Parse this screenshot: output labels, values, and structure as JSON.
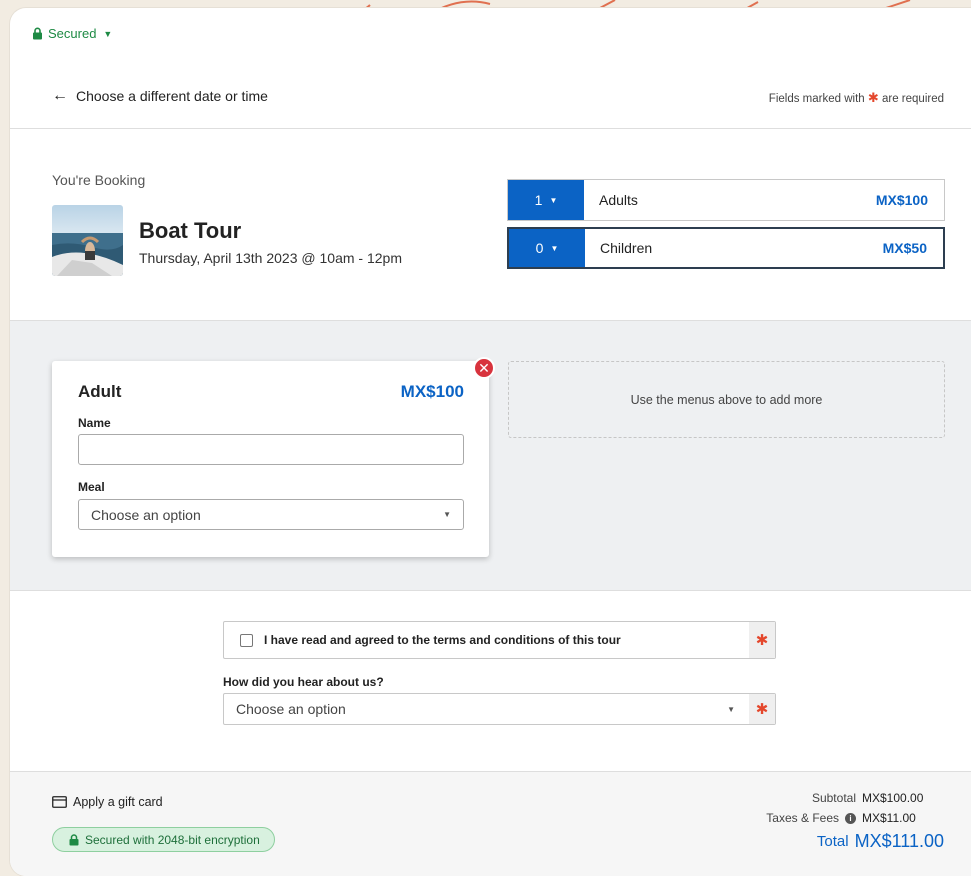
{
  "header": {
    "secured_label": "Secured",
    "back_label": "Choose a different date or time",
    "required_prefix": "Fields marked with",
    "required_star": "✱",
    "required_suffix": "are required"
  },
  "booking": {
    "label": "You're Booking",
    "title": "Boat Tour",
    "datetime": "Thursday, April 13th 2023 @ 10am - 12pm"
  },
  "tickets": [
    {
      "qty": "1",
      "name": "Adults",
      "price": "MX$100"
    },
    {
      "qty": "0",
      "name": "Children",
      "price": "MX$50"
    }
  ],
  "guest": {
    "title": "Adult",
    "price": "MX$100",
    "name_label": "Name",
    "name_value": "",
    "meal_label": "Meal",
    "meal_value": "Choose an option",
    "remove_glyph": "✕"
  },
  "add_more": "Use the menus above to add more",
  "terms": {
    "label": "I have read and agreed to the terms and conditions of this tour",
    "star": "✱"
  },
  "hear": {
    "label": "How did you hear about us?",
    "value": "Choose an option",
    "star": "✱"
  },
  "footer": {
    "gift_label": "Apply a gift card",
    "encryption_label": "Secured with 2048-bit encryption",
    "subtotal_label": "Subtotal",
    "subtotal_value": "MX$100.00",
    "taxes_label": "Taxes & Fees",
    "taxes_value": "MX$11.00",
    "total_label": "Total",
    "total_value": "MX$111.00"
  },
  "colors": {
    "accent_blue": "#0b63c5",
    "secure_green": "#1e8a44",
    "required_red": "#e4472c",
    "remove_red": "#d8333d"
  },
  "icons": {
    "lock": "lock-icon",
    "back": "arrow-left-icon",
    "dropdown": "caret-down-icon",
    "remove": "close-icon",
    "gift": "credit-card-icon",
    "info": "info-icon"
  }
}
